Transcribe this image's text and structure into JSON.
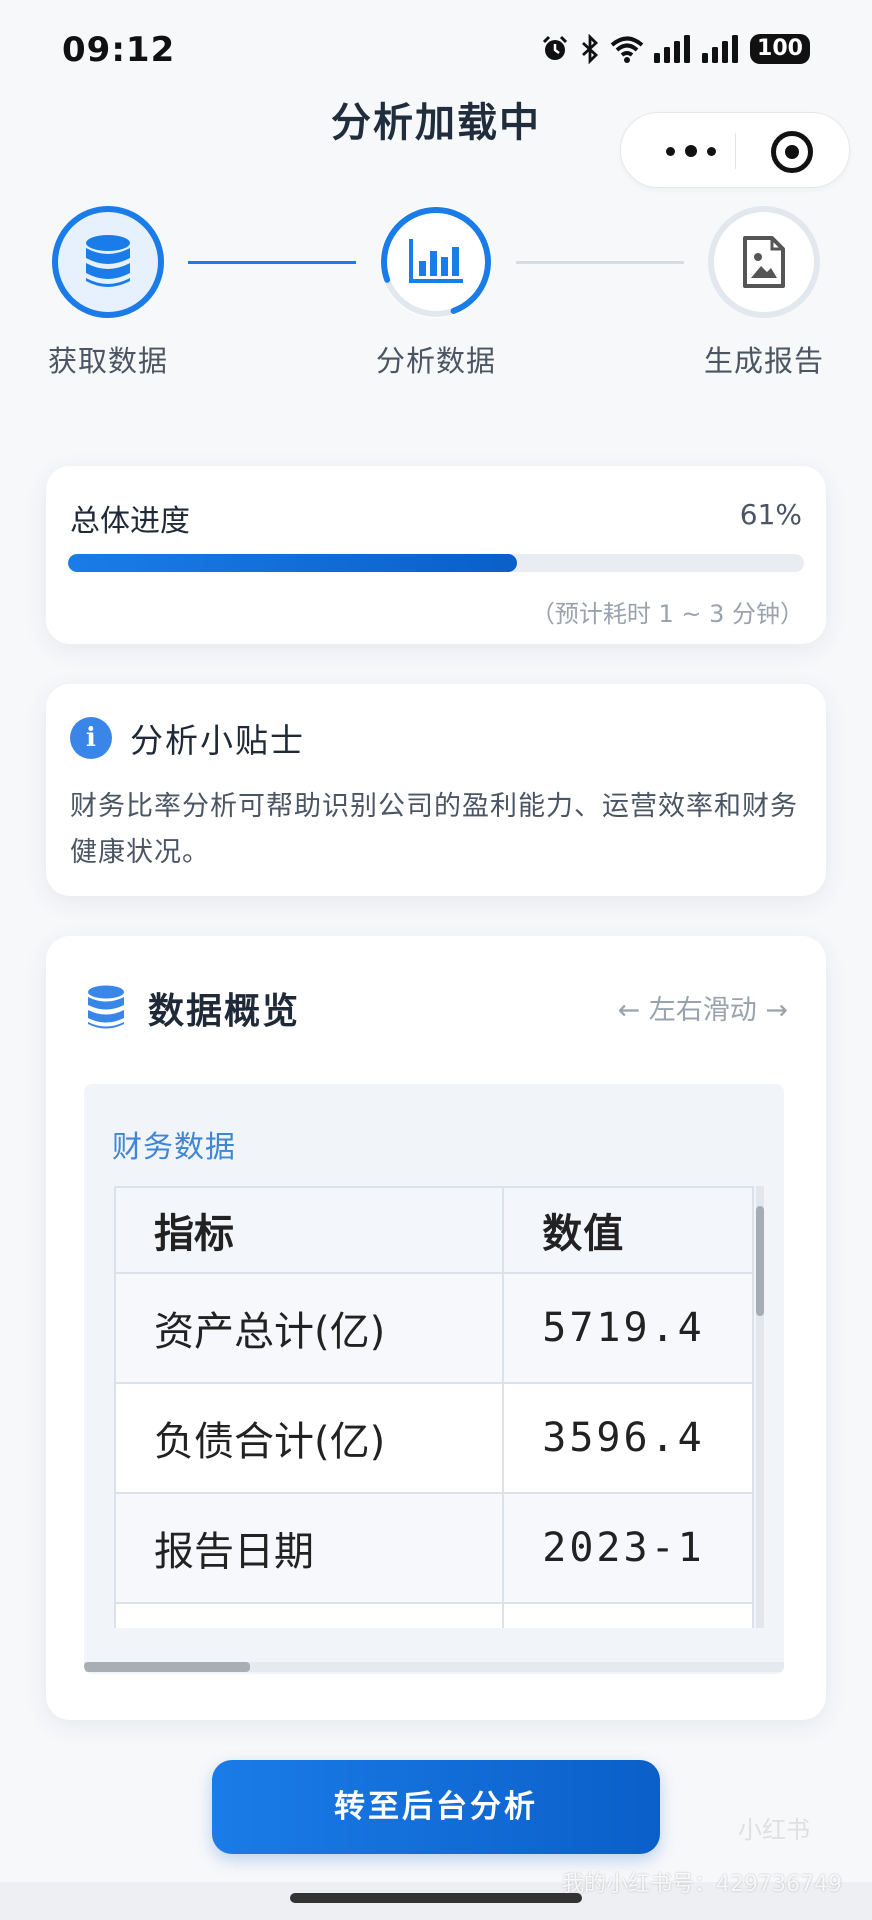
{
  "status_bar": {
    "time": "09:12",
    "battery": "100"
  },
  "header": {
    "title": "分析加载中"
  },
  "steps": [
    {
      "label": "获取数据",
      "state": "done",
      "icon": "database-icon"
    },
    {
      "label": "分析数据",
      "state": "active",
      "icon": "bar-chart-icon"
    },
    {
      "label": "生成报告",
      "state": "pending",
      "icon": "report-file-icon"
    }
  ],
  "progress": {
    "label": "总体进度",
    "percent_text": "61%",
    "percent": 61,
    "eta": "（预计耗时 1 ~ 3 分钟）"
  },
  "tip": {
    "title": "分析小贴士",
    "body": "财务比率分析可帮助识别公司的盈利能力、运营效率和财务健康状况。"
  },
  "overview": {
    "title": "数据概览",
    "scroll_hint": "← 左右滑动 →",
    "table": {
      "caption": "财务数据",
      "headers": [
        "指标",
        "数值"
      ],
      "rows": [
        [
          "资产总计(亿)",
          "5719.4"
        ],
        [
          "负债合计(亿)",
          "3596.4"
        ],
        [
          "报告日期",
          "2023-1"
        ],
        [
          "",
          ""
        ]
      ]
    }
  },
  "action": {
    "button_label": "转至后台分析"
  },
  "watermark": {
    "text": "我的小红书号：429736749",
    "logo": "小红书"
  },
  "colors": {
    "primary": "#1a7ce8",
    "primary_dark": "#0b5fc9",
    "info": "#3a86e8",
    "caption": "#3f86d4"
  }
}
